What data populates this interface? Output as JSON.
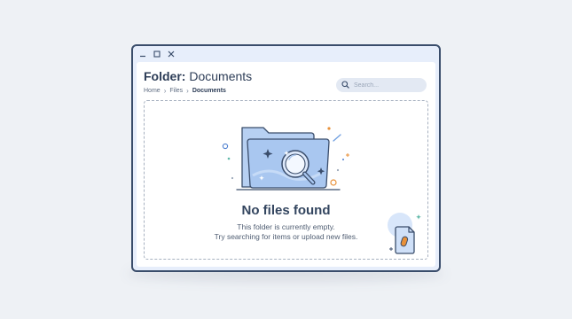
{
  "window": {
    "controls": {
      "minimize": "minimize-icon",
      "maximize": "maximize-icon",
      "close": "close-icon"
    }
  },
  "header": {
    "title_prefix": "Folder:",
    "title_name": "Documents"
  },
  "breadcrumb": [
    "Home",
    "Files",
    "Documents"
  ],
  "search": {
    "placeholder": "Search..."
  },
  "empty_state": {
    "title": "No files found",
    "line1": "This folder is currently empty.",
    "line2": "Try searching for items or upload new files."
  },
  "colors": {
    "frame": "#3a4d6b",
    "folder_blue": "#a9c7f0",
    "accent_orange": "#e8913a",
    "accent_teal": "#5fb8a8"
  }
}
